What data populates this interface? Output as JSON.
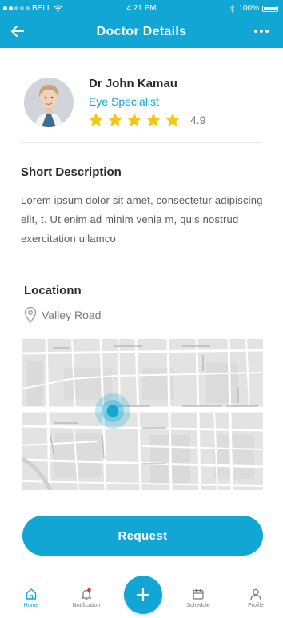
{
  "status_bar": {
    "carrier": "BELL",
    "time": "4:21 PM",
    "battery": "100%"
  },
  "header": {
    "title": "Doctor Details",
    "back_icon": "arrow-left-icon",
    "more_icon": "more-dots-icon"
  },
  "doctor": {
    "name": "Dr John Kamau",
    "specialty": "Eye Specialist",
    "rating_value": "4.9",
    "stars_filled": 5,
    "stars_total": 5
  },
  "description": {
    "title": "Short Description",
    "text": "Lorem ipsum dolor sit amet, consectetur adipiscing elit, t. Ut enim ad minim venia m, quis nostrud exercitation ullamco"
  },
  "location": {
    "title": "Locationn",
    "address": "Valley Road",
    "icon": "map-pin-icon"
  },
  "actions": {
    "request_label": "Request"
  },
  "colors": {
    "accent": "#11a6d4",
    "star": "#f5c518",
    "text_dark": "#2a2a2a",
    "text_muted": "#7a7a7a"
  },
  "bottom_nav": {
    "items": [
      {
        "label": "Home",
        "icon": "home-icon",
        "active": true
      },
      {
        "label": "Notification",
        "icon": "bell-icon",
        "active": false
      },
      {
        "label": "Schedule",
        "icon": "calendar-icon",
        "active": false
      },
      {
        "label": "Profile",
        "icon": "user-icon",
        "active": false
      }
    ],
    "fab_icon": "plus-icon"
  }
}
